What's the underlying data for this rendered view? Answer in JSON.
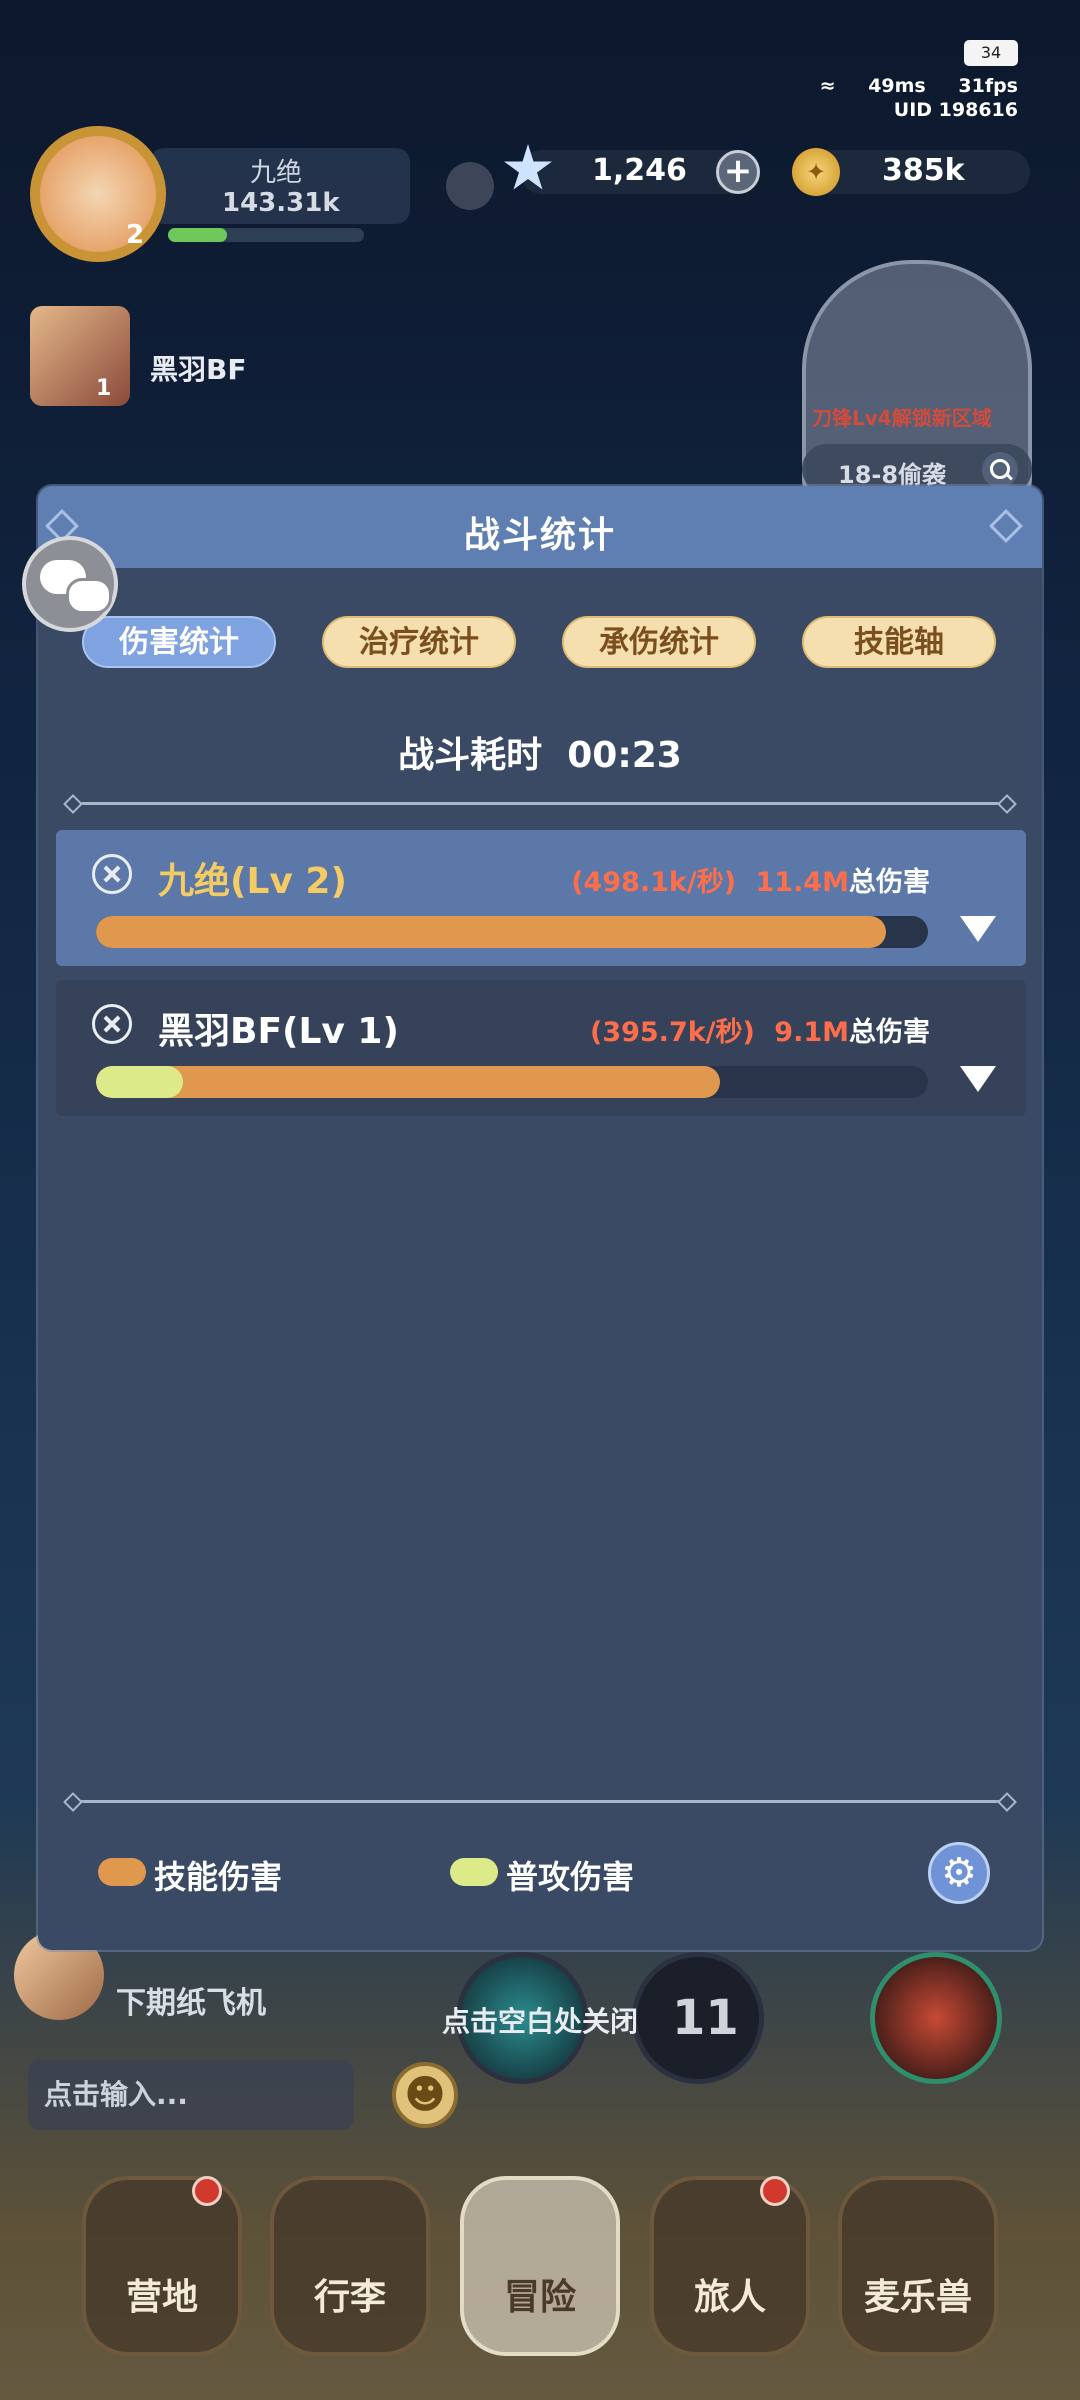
{
  "status": {
    "battery": "34",
    "ping": "49ms",
    "fps": "31fps",
    "uid": "UID 198616"
  },
  "player": {
    "name": "九绝",
    "power": "143.31k",
    "level": "2",
    "teammate_name": "黑羽BF",
    "teammate_level": "1"
  },
  "currency": {
    "gems": "1,246",
    "coins": "385k"
  },
  "map": {
    "caption": "刀锋Lv4解锁新区域",
    "stage": "18-8偷袭"
  },
  "modal": {
    "title": "战斗统计",
    "tabs": [
      "伤害统计",
      "治疗统计",
      "承伤统计",
      "技能轴"
    ],
    "active_tab": 0,
    "duration_label": "战斗耗时",
    "duration": "00:23",
    "rows": [
      {
        "name": "九绝(Lv 2)",
        "rate": "(498.1k/秒)",
        "total": "11.4M",
        "total_unit": "总伤害",
        "skill_fraction": 0.95,
        "normal_fraction": 0.0,
        "highlighted": true
      },
      {
        "name": "黑羽BF(Lv 1)",
        "rate": "(395.7k/秒)",
        "total": "9.1M",
        "total_unit": "总伤害",
        "skill_fraction": 0.75,
        "normal_fraction": 0.105,
        "highlighted": false
      }
    ],
    "legend": {
      "skill": "技能伤害",
      "normal": "普攻伤害"
    }
  },
  "colors": {
    "skill": "#e0984f",
    "normal": "#dcea8a",
    "header": "#5f7fb3",
    "accent_red": "#ff6e4a"
  },
  "bottom": {
    "close_hint": "点击空白处关闭",
    "news": "下期纸飞机",
    "chat_placeholder": "点击输入...",
    "orb_count": "11",
    "nav": [
      "营地",
      "行李",
      "冒险",
      "旅人",
      "麦乐兽"
    ],
    "nav_active": 2
  }
}
